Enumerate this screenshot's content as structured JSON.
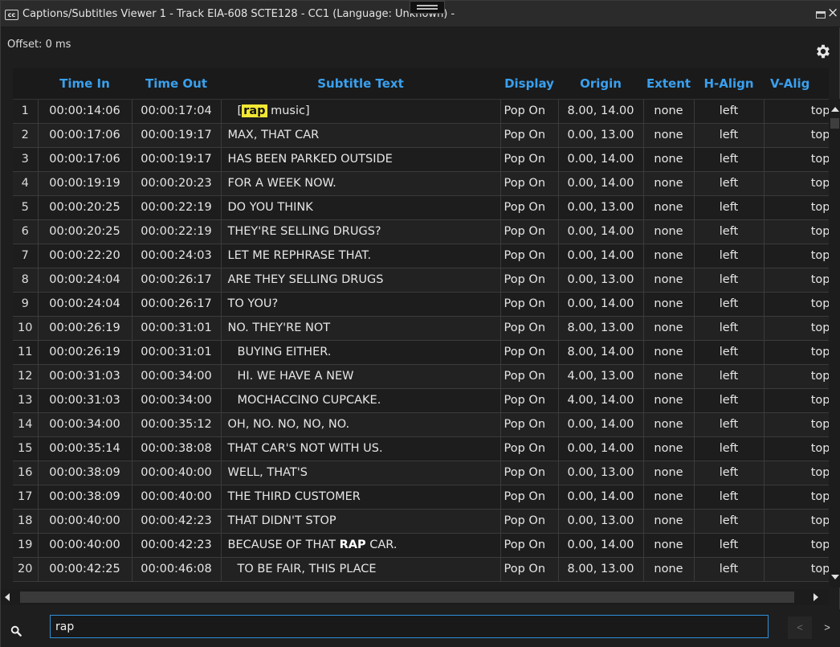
{
  "window": {
    "cc_icon": "cc",
    "title": "Captions/Subtitles Viewer 1 - Track EIA-608 SCTE128 - CC1 (Language: Unknown)  -"
  },
  "toolbar": {
    "offset_label": "Offset: 0 ms",
    "settings_icon": "gear-icon"
  },
  "table": {
    "columns": [
      "",
      "Time In",
      "Time Out",
      "Subtitle Text",
      "Display",
      "Origin",
      "Extent",
      "H-Align",
      "V-Alig"
    ],
    "rows": [
      {
        "n": "1",
        "in": "00:00:14:06",
        "out": "00:00:17:04",
        "pre": "[",
        "match": "rap",
        "post": " music]",
        "match_style": "highlight",
        "indent": true,
        "display": "Pop On",
        "origin": "8.00, 14.00",
        "extent": "none",
        "halign": "left",
        "valign": "top"
      },
      {
        "n": "2",
        "in": "00:00:17:06",
        "out": "00:00:19:17",
        "pre": "MAX, THAT CAR",
        "display": "Pop On",
        "origin": "0.00, 13.00",
        "extent": "none",
        "halign": "left",
        "valign": "top"
      },
      {
        "n": "3",
        "in": "00:00:17:06",
        "out": "00:00:19:17",
        "pre": "HAS BEEN PARKED OUTSIDE",
        "display": "Pop On",
        "origin": "0.00, 14.00",
        "extent": "none",
        "halign": "left",
        "valign": "top"
      },
      {
        "n": "4",
        "in": "00:00:19:19",
        "out": "00:00:20:23",
        "pre": "FOR A WEEK NOW.",
        "display": "Pop On",
        "origin": "0.00, 14.00",
        "extent": "none",
        "halign": "left",
        "valign": "top"
      },
      {
        "n": "5",
        "in": "00:00:20:25",
        "out": "00:00:22:19",
        "pre": "DO YOU THINK",
        "display": "Pop On",
        "origin": "0.00, 13.00",
        "extent": "none",
        "halign": "left",
        "valign": "top"
      },
      {
        "n": "6",
        "in": "00:00:20:25",
        "out": "00:00:22:19",
        "pre": "THEY'RE SELLING DRUGS?",
        "display": "Pop On",
        "origin": "0.00, 14.00",
        "extent": "none",
        "halign": "left",
        "valign": "top"
      },
      {
        "n": "7",
        "in": "00:00:22:20",
        "out": "00:00:24:03",
        "pre": "LET ME REPHRASE THAT.",
        "display": "Pop On",
        "origin": "0.00, 14.00",
        "extent": "none",
        "halign": "left",
        "valign": "top"
      },
      {
        "n": "8",
        "in": "00:00:24:04",
        "out": "00:00:26:17",
        "pre": "ARE THEY SELLING DRUGS",
        "display": "Pop On",
        "origin": "0.00, 13.00",
        "extent": "none",
        "halign": "left",
        "valign": "top"
      },
      {
        "n": "9",
        "in": "00:00:24:04",
        "out": "00:00:26:17",
        "pre": "TO YOU?",
        "display": "Pop On",
        "origin": "0.00, 14.00",
        "extent": "none",
        "halign": "left",
        "valign": "top"
      },
      {
        "n": "10",
        "in": "00:00:26:19",
        "out": "00:00:31:01",
        "pre": "NO. THEY'RE NOT",
        "display": "Pop On",
        "origin": "8.00, 13.00",
        "extent": "none",
        "halign": "left",
        "valign": "top"
      },
      {
        "n": "11",
        "in": "00:00:26:19",
        "out": "00:00:31:01",
        "pre": "BUYING EITHER.",
        "indent": true,
        "display": "Pop On",
        "origin": "8.00, 14.00",
        "extent": "none",
        "halign": "left",
        "valign": "top"
      },
      {
        "n": "12",
        "in": "00:00:31:03",
        "out": "00:00:34:00",
        "pre": "HI. WE HAVE A NEW",
        "indent": true,
        "display": "Pop On",
        "origin": "4.00, 13.00",
        "extent": "none",
        "halign": "left",
        "valign": "top"
      },
      {
        "n": "13",
        "in": "00:00:31:03",
        "out": "00:00:34:00",
        "pre": "MOCHACCINO CUPCAKE.",
        "indent": true,
        "display": "Pop On",
        "origin": "4.00, 14.00",
        "extent": "none",
        "halign": "left",
        "valign": "top"
      },
      {
        "n": "14",
        "in": "00:00:34:00",
        "out": "00:00:35:12",
        "pre": "OH, NO. NO, NO, NO.",
        "display": "Pop On",
        "origin": "0.00, 14.00",
        "extent": "none",
        "halign": "left",
        "valign": "top"
      },
      {
        "n": "15",
        "in": "00:00:35:14",
        "out": "00:00:38:08",
        "pre": "THAT CAR'S NOT WITH US.",
        "display": "Pop On",
        "origin": "0.00, 14.00",
        "extent": "none",
        "halign": "left",
        "valign": "top"
      },
      {
        "n": "16",
        "in": "00:00:38:09",
        "out": "00:00:40:00",
        "pre": "WELL, THAT'S",
        "display": "Pop On",
        "origin": "0.00, 13.00",
        "extent": "none",
        "halign": "left",
        "valign": "top"
      },
      {
        "n": "17",
        "in": "00:00:38:09",
        "out": "00:00:40:00",
        "pre": "THE THIRD CUSTOMER",
        "display": "Pop On",
        "origin": "0.00, 14.00",
        "extent": "none",
        "halign": "left",
        "valign": "top"
      },
      {
        "n": "18",
        "in": "00:00:40:00",
        "out": "00:00:42:23",
        "pre": "THAT DIDN'T STOP",
        "display": "Pop On",
        "origin": "0.00, 13.00",
        "extent": "none",
        "halign": "left",
        "valign": "top"
      },
      {
        "n": "19",
        "in": "00:00:40:00",
        "out": "00:00:42:23",
        "pre": "BECAUSE OF THAT ",
        "match": "RAP",
        "post": " CAR.",
        "match_style": "bold",
        "display": "Pop On",
        "origin": "0.00, 14.00",
        "extent": "none",
        "halign": "left",
        "valign": "top"
      },
      {
        "n": "20",
        "in": "00:00:42:25",
        "out": "00:00:46:08",
        "pre": "TO BE FAIR, THIS PLACE",
        "indent": true,
        "display": "Pop On",
        "origin": "8.00, 13.00",
        "extent": "none",
        "halign": "left",
        "valign": "top"
      }
    ]
  },
  "search": {
    "icon": "search-icon",
    "value": "rap",
    "prev_label": "<",
    "next_label": ">"
  },
  "colors": {
    "header_text": "#3aa0ee",
    "highlight": "#f2e733",
    "input_border": "#2f8fd8"
  }
}
